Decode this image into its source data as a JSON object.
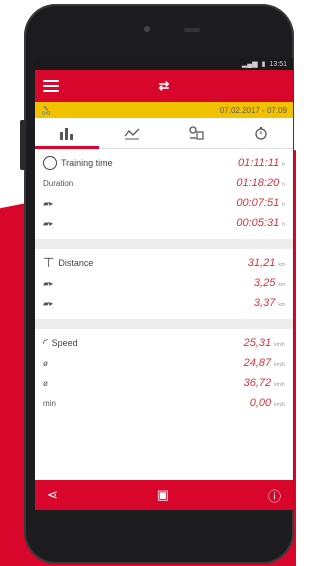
{
  "status_bar": {
    "text": "13:51",
    "battery": "100%"
  },
  "appbar": {
    "menu_icon": "menu-icon",
    "logo_icon": "sync-logo-icon"
  },
  "date_bar": {
    "icon": "cyclist-icon",
    "date_range": "07.02.2017 - 07.09"
  },
  "tabs": [
    {
      "icon": "bar-chart-icon",
      "active": true
    },
    {
      "icon": "line-chart-icon",
      "active": false
    },
    {
      "icon": "rider-stats-icon",
      "active": false
    },
    {
      "icon": "stopwatch-icon",
      "active": false
    }
  ],
  "training": {
    "title": "Training time",
    "title_value": "01:11:11",
    "duration_label": "Duration",
    "duration_value": "01:18:20",
    "row2_value": "00:07:51",
    "row3_value": "00:05:31",
    "unit": "h"
  },
  "distance": {
    "title": "Distance",
    "title_value": "31,21",
    "row1_value": "3,25",
    "row2_value": "3,37",
    "unit": "km"
  },
  "speed": {
    "title": "Speed",
    "title_value": "25,31",
    "row1_label": "ø",
    "row1_value": "24,87",
    "row2_label": "ø",
    "row2_value": "36,72",
    "row3_label": "min",
    "row3_value": "0,00",
    "unit": "km/h"
  },
  "bottom_bar": {
    "share_icon": "share-icon",
    "device_icon": "device-icon",
    "info_icon": "info-icon"
  },
  "colors": {
    "accent": "#d9062b",
    "date_bar": "#f2c200",
    "value_red": "#e0303f"
  }
}
